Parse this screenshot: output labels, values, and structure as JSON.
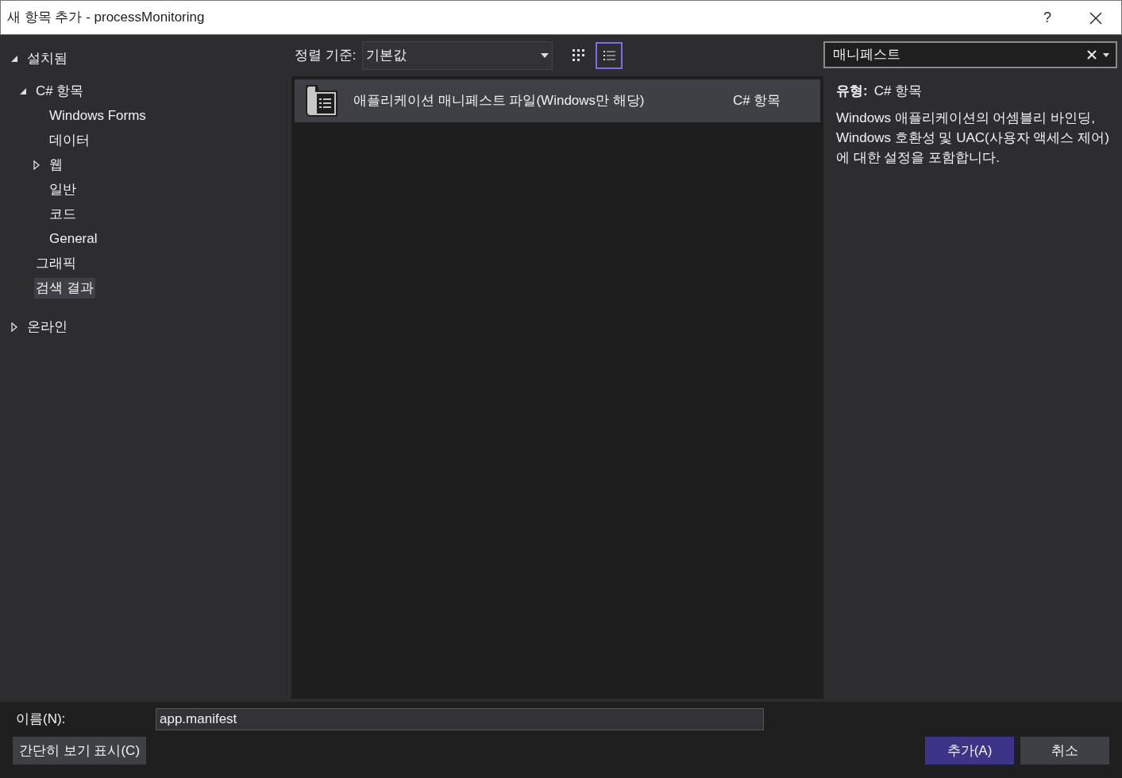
{
  "window": {
    "title": "새 항목 추가 - processMonitoring",
    "help": "?"
  },
  "tree": [
    {
      "label": "설치됨",
      "expanded": true,
      "selected": false,
      "children": [
        {
          "label": "C# 항목",
          "expanded": true,
          "selected": false,
          "children": [
            {
              "label": "Windows Forms",
              "selected": false
            },
            {
              "label": "데이터",
              "selected": false
            },
            {
              "label": "웹",
              "expanded": false,
              "selected": false
            },
            {
              "label": "일반",
              "selected": false
            },
            {
              "label": "코드",
              "selected": false
            },
            {
              "label": "General",
              "selected": false
            }
          ]
        },
        {
          "label": "그래픽",
          "selected": false
        },
        {
          "label": "검색 결과",
          "selected": true
        }
      ]
    },
    {
      "label": "온라인",
      "expanded": false,
      "selected": false
    }
  ],
  "toolbar": {
    "sort_label": "정렬 기준:",
    "sort_value": "기본값",
    "views": [
      {
        "kind": "grid",
        "selected": false
      },
      {
        "kind": "list",
        "selected": true
      }
    ]
  },
  "templates": [
    {
      "name": "애플리케이션 매니페스트 파일(Windows만 해당)",
      "type": "C# 항목",
      "selected": true
    }
  ],
  "search": {
    "value": "매니페스트"
  },
  "details": {
    "type_label": "유형:",
    "type_value": "C# 항목",
    "description": "Windows 애플리케이션의 어셈블리 바인딩, Windows 호환성 및 UAC(사용자 액세스 제어)에 대한 설정을 포함합니다."
  },
  "name_field": {
    "label": "이름(N):",
    "value": "app.manifest"
  },
  "buttons": {
    "compact": "간단히 보기 표시(C)",
    "add": "추가(A)",
    "cancel": "취소"
  }
}
